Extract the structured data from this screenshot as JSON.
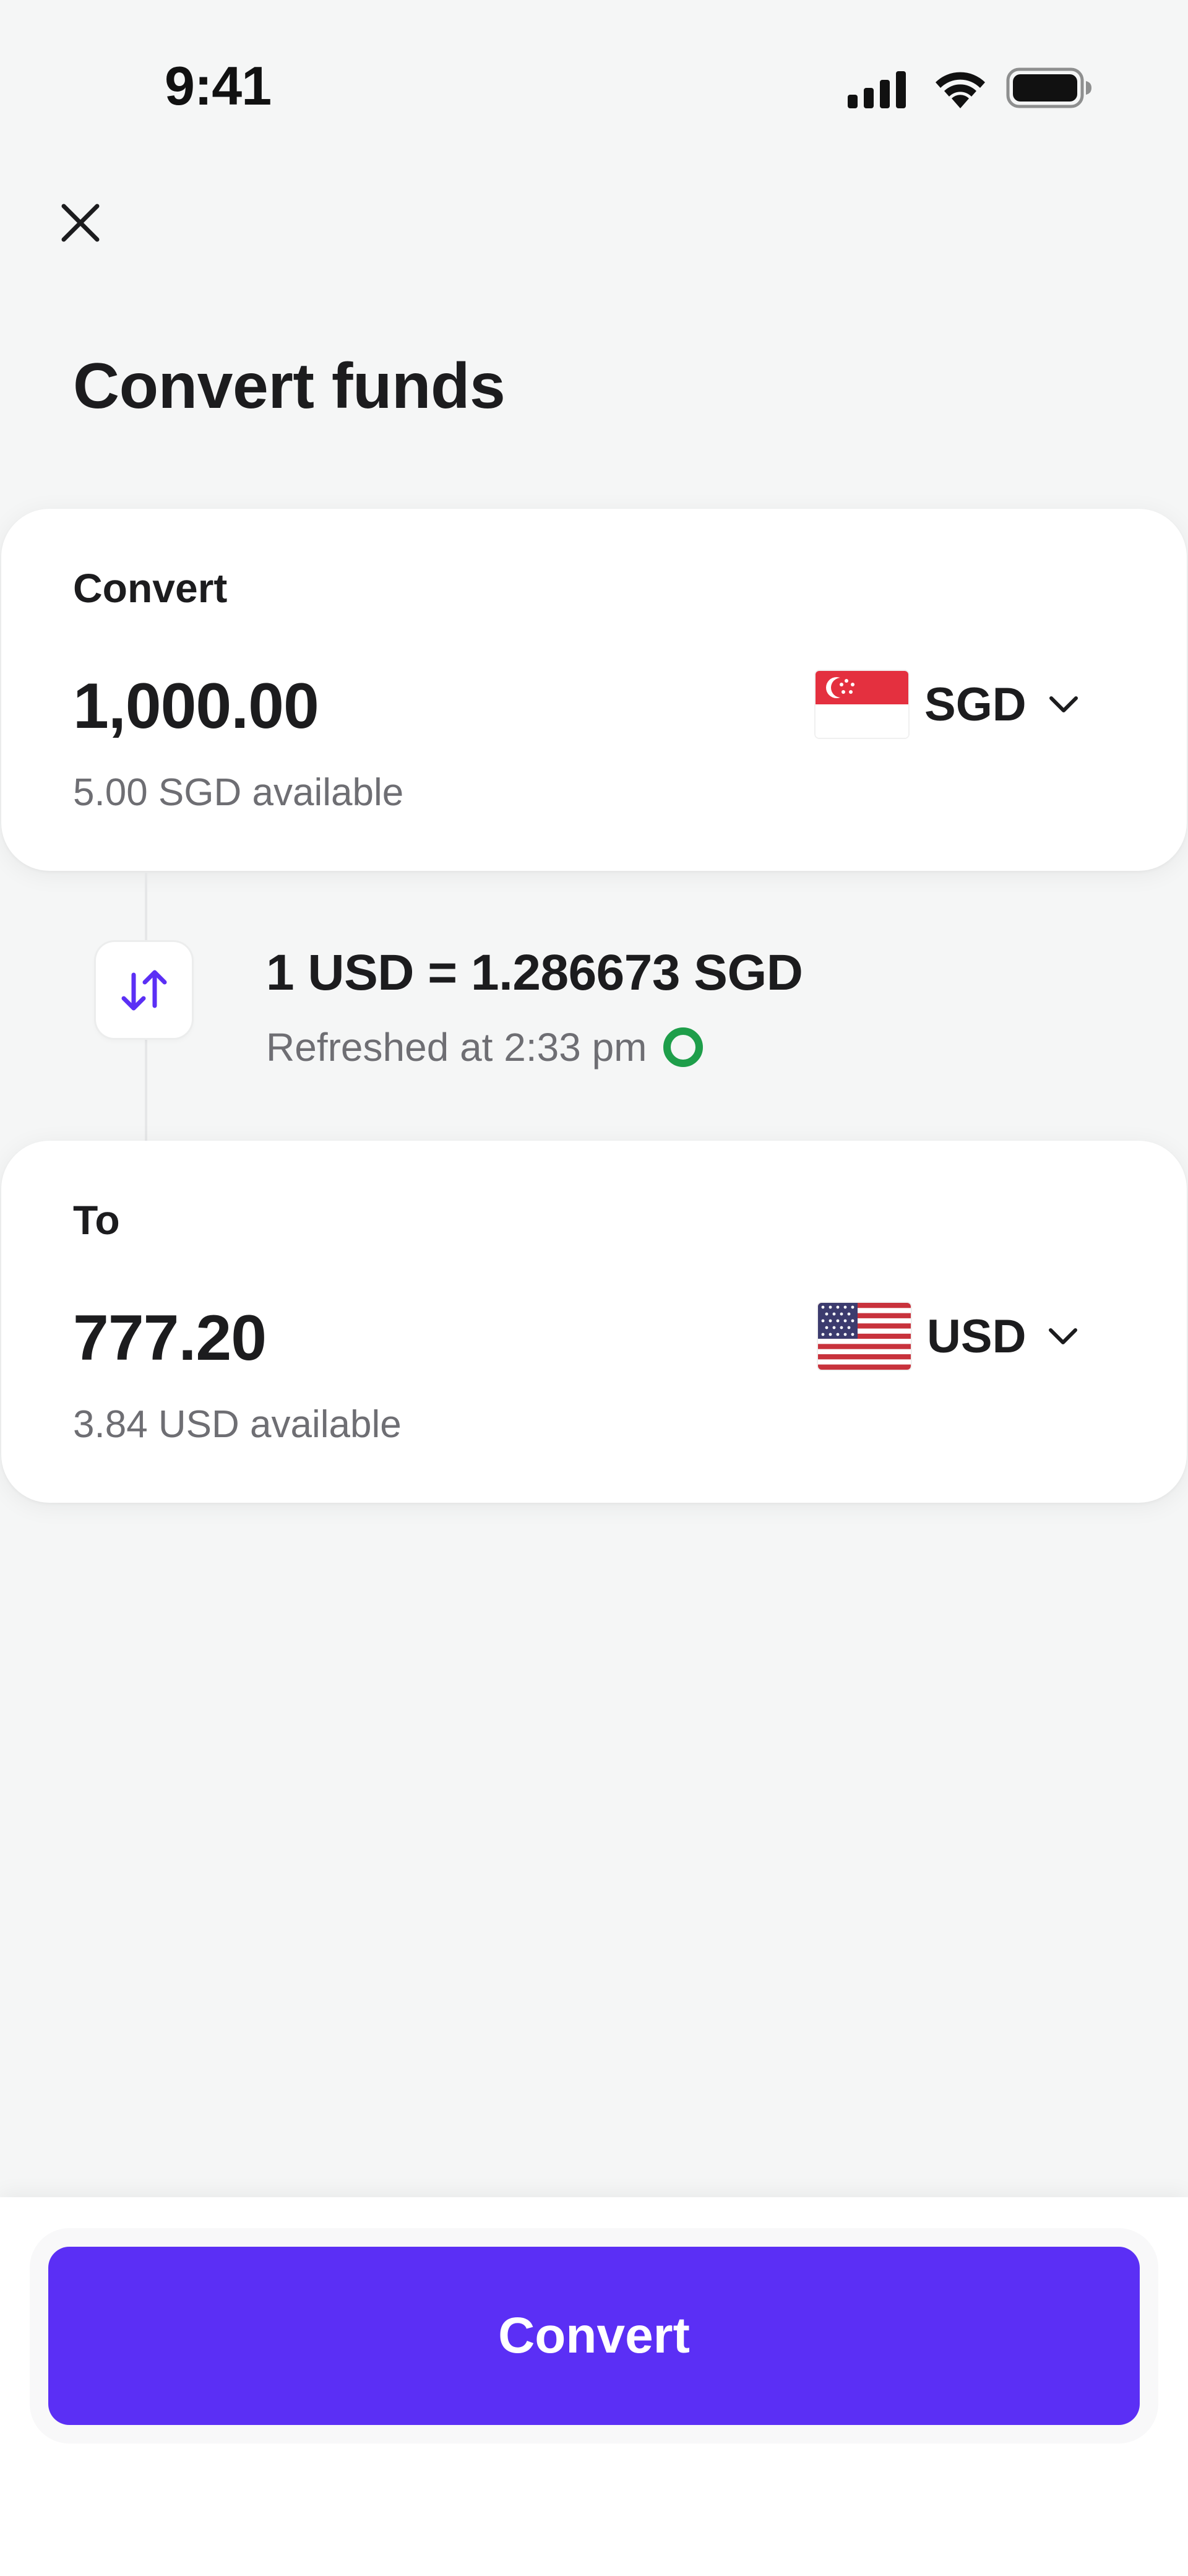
{
  "status_bar": {
    "time": "9:41",
    "icons": [
      "signal-icon",
      "wifi-icon",
      "battery-icon"
    ]
  },
  "header": {
    "close_icon": "close-icon",
    "title": "Convert funds"
  },
  "from_card": {
    "label": "Convert",
    "amount": "1,000.00",
    "available": "5.00 SGD available",
    "currency": "SGD",
    "flag_icon": "singapore-flag-icon"
  },
  "rate": {
    "text": "1 USD = 1.286673 SGD",
    "refreshed": "Refreshed at 2:33 pm",
    "swap_icon": "swap-arrows-icon",
    "refresh_icon": "refresh-ring-icon"
  },
  "to_card": {
    "label": "To",
    "amount": "777.20",
    "available": "3.84 USD available",
    "currency": "USD",
    "flag_icon": "us-flag-icon"
  },
  "footer": {
    "convert_label": "Convert"
  },
  "colors": {
    "accent": "#5b2ff5",
    "background": "#f5f6f6",
    "card": "#ffffff",
    "text_primary": "#1c1c1e",
    "text_secondary": "#6e6e73",
    "refresh_green": "#1e9e4a",
    "sg_red": "#e4303f",
    "us_red": "#c8323c",
    "us_blue": "#3c3b6e"
  }
}
